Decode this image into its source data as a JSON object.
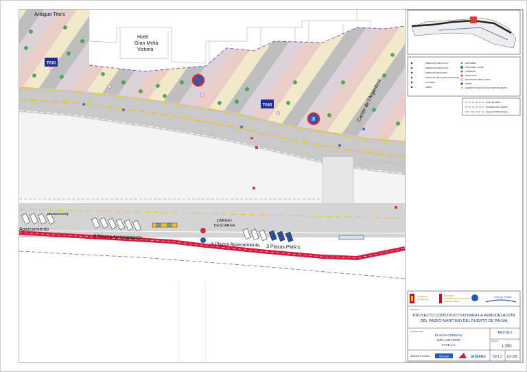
{
  "map": {
    "labels": {
      "antiguo": "Antiguo Tito's",
      "hotel_line1": "Hotel",
      "hotel_line2": "Gran Meliá",
      "hotel_line3": "Victoria",
      "street": "Carrer de l'Argentina",
      "taxi": "TAXI",
      "carga_line1": "CARGA /",
      "carga_line2": "DESCARGA",
      "plazas8": "8 Plazas Aparcamiento",
      "plazas3": "3 Plazas Aparcamiento",
      "plazas_pmr": "3 Plazas PMR's",
      "aparcamiento_left": "Aparcamiento",
      "fragment_left": "Aparcamiento"
    }
  },
  "legend": {
    "left_items": [
      "SEMAFORO VEHICULOS",
      "SEMAFORO VEHICULOS",
      "SEMAFORO PEATONES",
      "SEMAFORO PEATONES INVIDENTES",
      "COLUMNA",
      "ARBOL"
    ],
    "right_items": [
      "MANTENER",
      "MANTENER + ZONA",
      "SUMIDERO",
      "DESPLAZAR",
      "EN ESTUDIO DESPLAZADO",
      "NUEVO",
      "ELEMENTO NUEVO ANULADO TEMPORALMENTE"
    ],
    "lines": [
      "LINEA DE OBRA",
      "BARRERA NEW JERSEY",
      "VALLADO PROVISIONAL"
    ]
  },
  "title_block": {
    "project_small": "PROYECTO",
    "project_line1": "PROYECTO CONSTRUCTIVO PARA LA REMODELACIÓN",
    "project_line2": "DEL PASEO MARÍTIMO DEL PUERTO DE PALMA",
    "plan_small": "DESIGNACIÓN",
    "plan_line1": "PLANTA GENERAL",
    "plan_line2": "IMPLANTACIÓN",
    "plan_line3": "FASE 2.A",
    "rev": "REV.00.0",
    "escala_label": "ESCALA",
    "scale": "1:250",
    "sheet": "00.1.2",
    "date": "03-JUL",
    "port": "Port de Palma",
    "gov_line1": "GOBIERNO",
    "gov_line2": "DE ESPAÑA",
    "ministry_line1": "MINISTERIO",
    "ministry_line2": "DE TRANSPORTES, MOVILIDAD",
    "ministry_line3": "Y AGENDA URBANA",
    "logo1": "Autoritat Portuària",
    "logo2": "urbiens",
    "logo3": "ARDIMA"
  }
}
